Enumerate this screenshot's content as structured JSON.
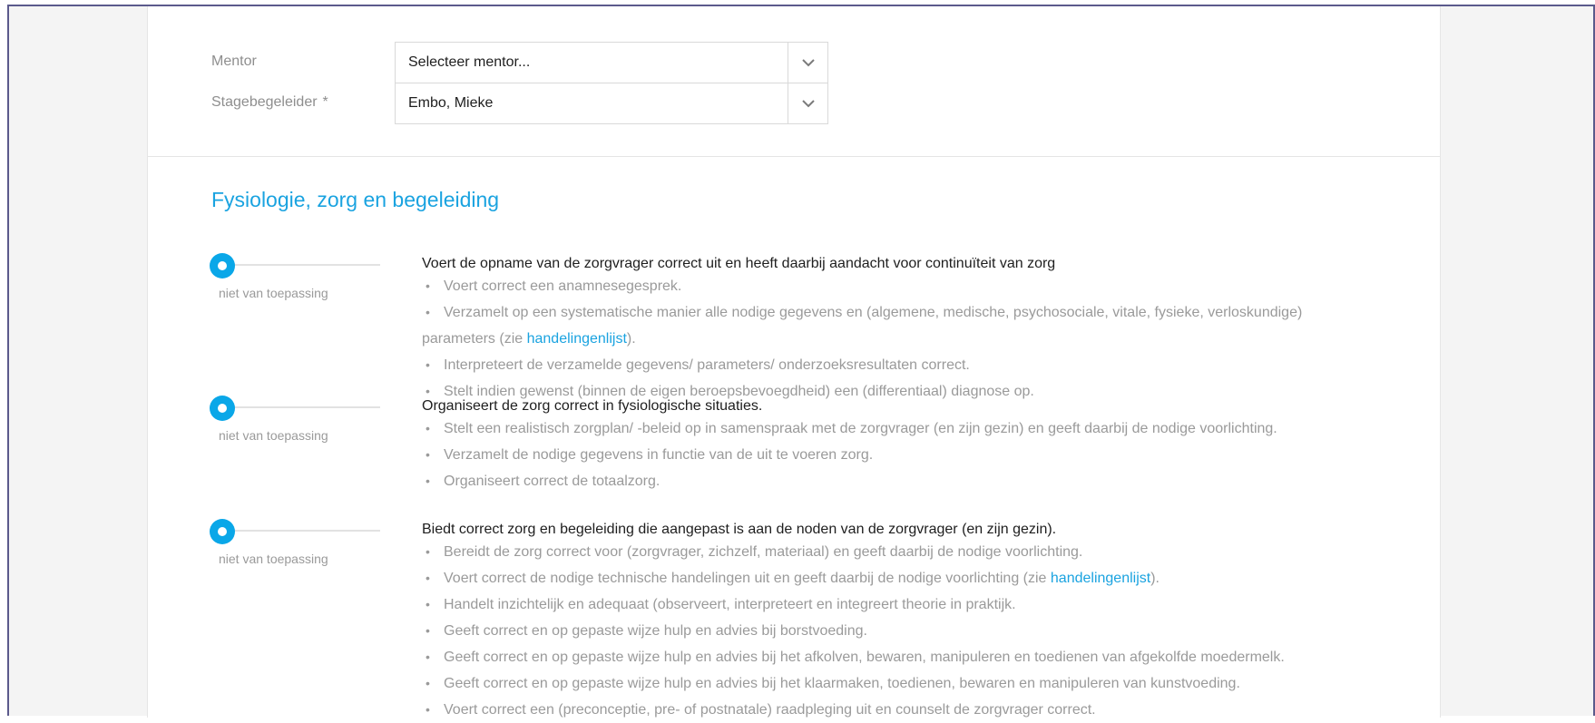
{
  "form": {
    "mentor": {
      "label": "Mentor",
      "value": "Selecteer mentor..."
    },
    "stagebegeleider": {
      "label": "Stagebegeleider",
      "required_mark": "*",
      "value": "Embo, Mieke"
    }
  },
  "section": {
    "title": "Fysiologie, zorg en begeleiding",
    "criteria": [
      {
        "slider_label": "niet van toepassing",
        "slider_level": 0,
        "title": "Voert de opname van de zorgvrager correct uit en heeft daarbij aandacht voor continuïteit van zorg",
        "bullets": [
          {
            "text": "Voert correct een anamnesegesprek."
          },
          {
            "text": "Verzamelt op een systematische manier alle nodige gegevens en (algemene, medische, psychosociale, vitale, fysieke, verloskundige)",
            "cont": "parameters (zie ",
            "link": "handelingenlijst",
            "after": ")."
          },
          {
            "text": "Interpreteert de verzamelde gegevens/ parameters/ onderzoeksresultaten correct."
          },
          {
            "text": "Stelt indien gewenst (binnen de eigen beroepsbevoegdheid) een (differentiaal) diagnose op."
          }
        ]
      },
      {
        "slider_label": "niet van toepassing",
        "slider_level": 0,
        "title": "Organiseert de zorg correct in fysiologische situaties.",
        "bullets": [
          {
            "text": "Stelt een realistisch zorgplan/ -beleid op in samenspraak met de zorgvrager (en zijn gezin) en geeft daarbij de nodige voorlichting."
          },
          {
            "text": "Verzamelt de nodige gegevens in functie van de uit te voeren zorg."
          },
          {
            "text": "Organiseert correct de totaalzorg."
          }
        ]
      },
      {
        "slider_label": "niet van toepassing",
        "slider_level": 0,
        "title": "Biedt correct zorg en begeleiding die aangepast is aan de noden van de zorgvrager (en zijn gezin).",
        "bullets": [
          {
            "text": "Bereidt de zorg correct voor (zorgvrager, zichzelf, materiaal) en geeft daarbij de nodige voorlichting."
          },
          {
            "text": "Voert correct de nodige technische handelingen uit en geeft daarbij de nodige voorlichting (zie ",
            "link": "handelingenlijst",
            "after": ")."
          },
          {
            "text": "Handelt inzichtelijk en adequaat (observeert, interpreteert en integreert theorie in praktijk."
          },
          {
            "text": "Geeft correct en op gepaste wijze hulp en advies bij borstvoeding."
          },
          {
            "text": "Geeft correct en op gepaste wijze hulp en advies bij het afkolven, bewaren, manipuleren en toedienen van afgekolfde moedermelk."
          },
          {
            "text": "Geeft correct en op gepaste wijze hulp en advies bij het klaarmaken, toedienen, bewaren en manipuleren van kunstvoeding."
          },
          {
            "text": "Voert correct een (preconceptie, pre- of postnatale) raadpleging uit en counselt de zorgvrager correct."
          }
        ]
      }
    ]
  },
  "colors": {
    "accent": "#0aa7e8",
    "title": "#1aa3e0",
    "muted": "#9a9a9a"
  }
}
